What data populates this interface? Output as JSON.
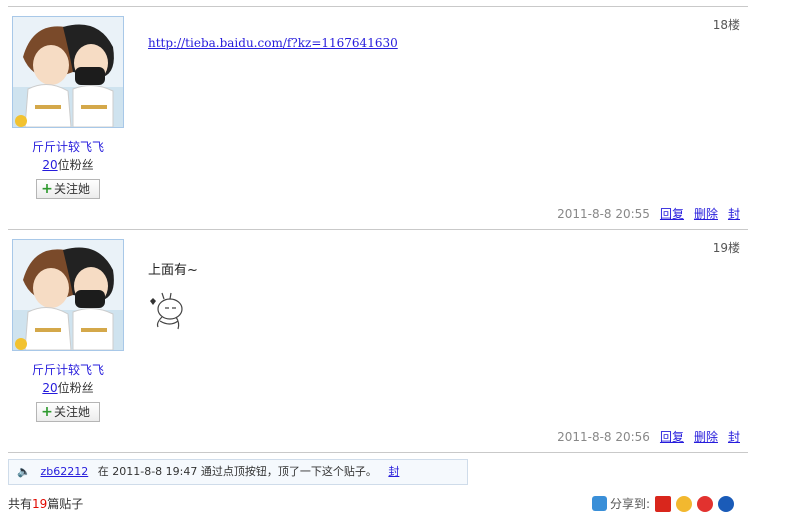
{
  "posts": [
    {
      "user_name": "斤斤计较飞飞",
      "fans_count": "20",
      "fans_suffix": "位粉丝",
      "follow_label": "关注她",
      "floor": "18楼",
      "content_link": "http://tieba.baidu.com/f?kz=1167641630",
      "time": "2011-8-8 20:55",
      "actions": [
        "回复",
        "删除",
        "封"
      ]
    },
    {
      "user_name": "斤斤计较飞飞",
      "fans_count": "20",
      "fans_suffix": "位粉丝",
      "follow_label": "关注她",
      "floor": "19楼",
      "content_text": "上面有~",
      "time": "2011-8-8 20:56",
      "actions": [
        "回复",
        "删除",
        "封"
      ]
    }
  ],
  "notice": {
    "user": "zb62212",
    "text": "在 2011-8-8 19:47 通过点顶按钮，顶了一下这个贴子。",
    "action": "封"
  },
  "footer": {
    "prefix": "共有",
    "count": "19",
    "suffix": "篇贴子"
  },
  "share": {
    "label": "分享到:",
    "icons": [
      "baidu-share-icon",
      "qzone-icon",
      "weibo-icon",
      "renren-icon"
    ]
  },
  "colors": {
    "link": "#261cdc",
    "count_red": "#e10900",
    "divider": "#c9c9c9"
  }
}
